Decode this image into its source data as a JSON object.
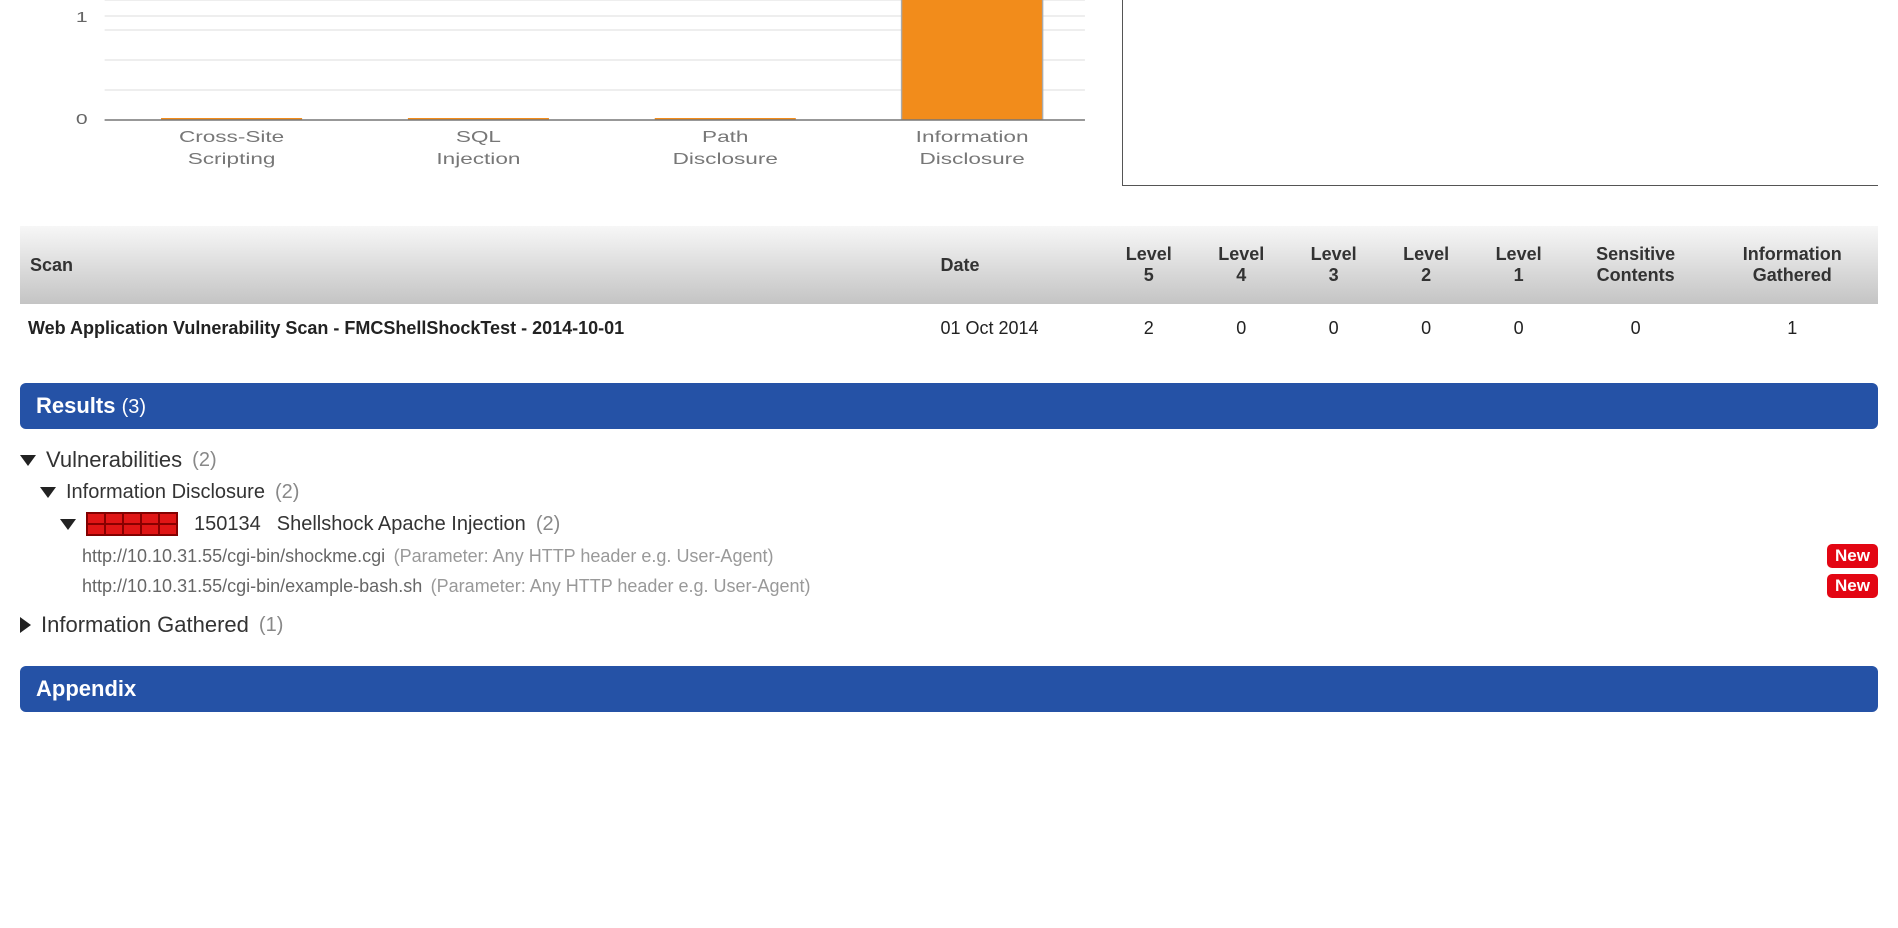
{
  "chart_data": {
    "type": "bar",
    "categories": [
      "Cross-Site Scripting",
      "SQL Injection",
      "Path Disclosure",
      "Information Disclosure"
    ],
    "values": [
      0,
      0,
      0,
      2
    ],
    "bar_color": "#f28c1b",
    "yticks": [
      0,
      1
    ],
    "ylim": [
      0,
      2
    ]
  },
  "table": {
    "headers": [
      "Scan",
      "Date",
      "Level 5",
      "Level 4",
      "Level 3",
      "Level 2",
      "Level 1",
      "Sensitive Contents",
      "Information Gathered"
    ],
    "row": {
      "scan": "Web Application Vulnerability Scan - FMCShellShockTest - 2014-10-01",
      "date": "01 Oct 2014",
      "l5": "2",
      "l4": "0",
      "l3": "0",
      "l2": "0",
      "l1": "0",
      "sc": "0",
      "ig": "1"
    }
  },
  "results": {
    "title": "Results",
    "count": "(3)",
    "vuln_label": "Vulnerabilities",
    "vuln_count": "(2)",
    "info_disc_label": "Information Disclosure",
    "info_disc_count": "(2)",
    "finding_id": "150134",
    "finding_title": "Shellshock Apache Injection",
    "finding_count": "(2)",
    "link1_url": "http://10.10.31.55/cgi-bin/shockme.cgi",
    "link1_param": "(Parameter: Any HTTP header e.g. User-Agent)",
    "link2_url": "http://10.10.31.55/cgi-bin/example-bash.sh",
    "link2_param": "(Parameter: Any HTTP header e.g. User-Agent)",
    "new_badge": "New",
    "ig_label": "Information Gathered",
    "ig_count": "(1)"
  },
  "appendix_title": "Appendix"
}
